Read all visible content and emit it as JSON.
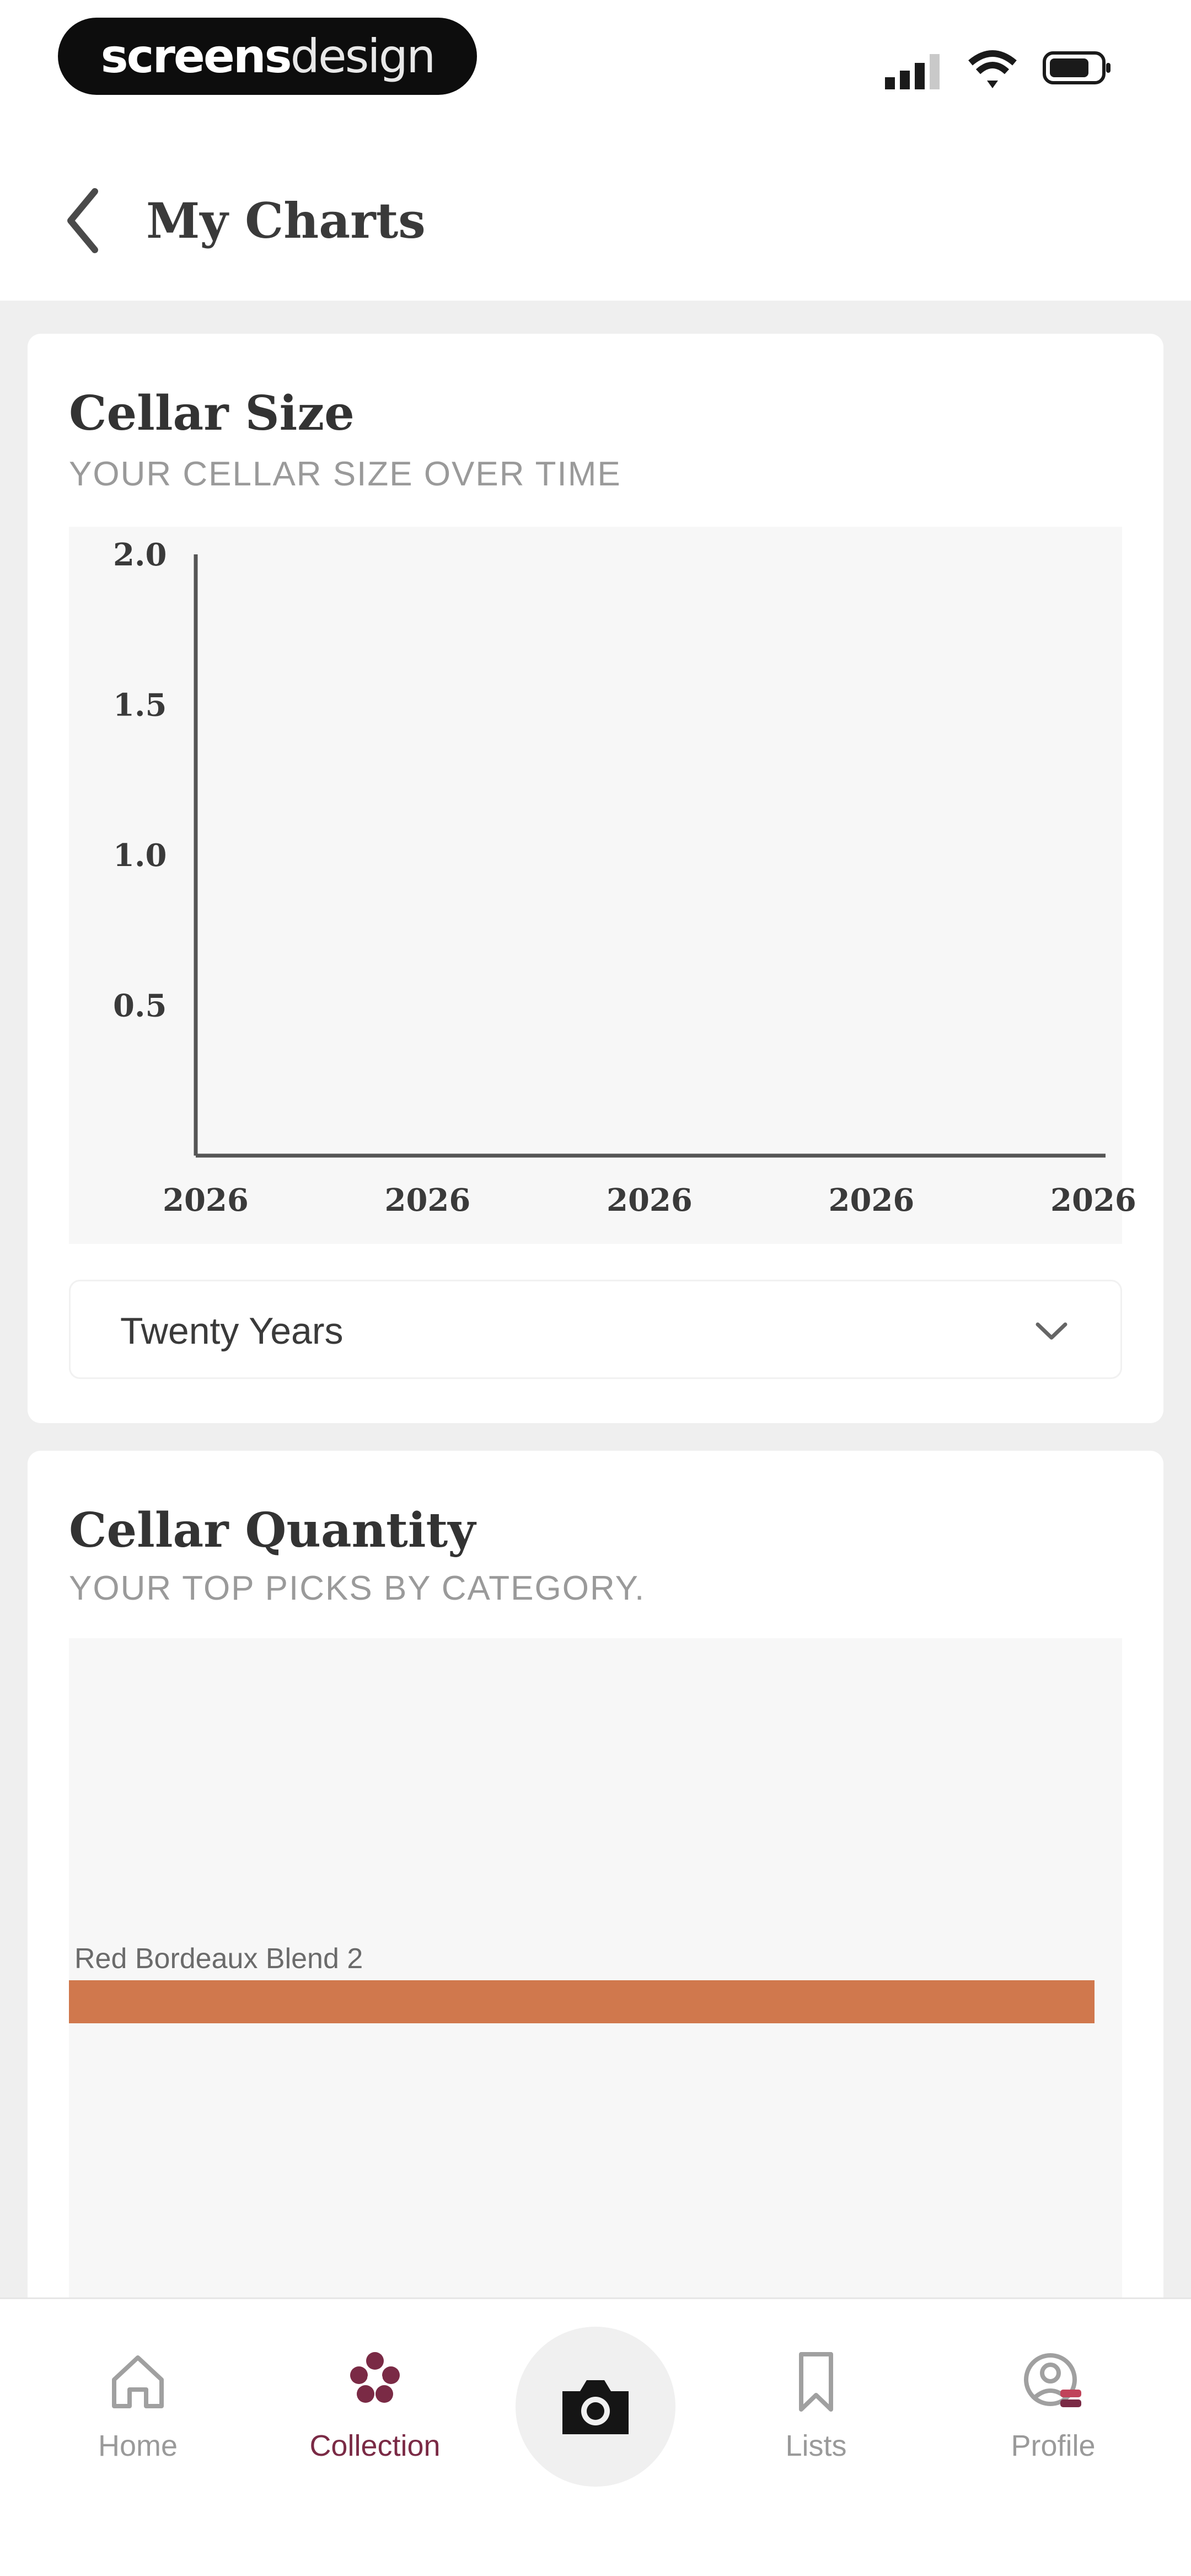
{
  "status_bar": {
    "brand_bold": "screens",
    "brand_light": "design"
  },
  "header": {
    "title": "My Charts",
    "back_icon": "chevron-left-icon"
  },
  "cellar_size_card": {
    "title": "Cellar Size",
    "subtitle": "YOUR CELLAR SIZE OVER TIME",
    "range_select": {
      "value": "Twenty Years",
      "icon": "chevron-down-icon"
    }
  },
  "cellar_quantity_card": {
    "title": "Cellar Quantity",
    "subtitle": "YOUR TOP PICKS BY CATEGORY."
  },
  "chart_data": [
    {
      "type": "line",
      "title": "Cellar Size",
      "subtitle": "YOUR CELLAR SIZE OVER TIME",
      "x_tick_labels": [
        "2026",
        "2026",
        "2026",
        "2026",
        "2026"
      ],
      "y_tick_labels": [
        "2.0",
        "1.5",
        "1.0",
        "0.5"
      ],
      "y_ticks": [
        2.0,
        1.5,
        1.0,
        0.5
      ],
      "ylim": [
        0,
        2.0
      ],
      "series": [],
      "grid": false
    },
    {
      "type": "bar",
      "orientation": "horizontal",
      "title": "Cellar Quantity",
      "subtitle": "YOUR TOP PICKS BY CATEGORY.",
      "categories": [
        "Red Bordeaux Blend 2"
      ],
      "values": [
        2
      ],
      "xlim": [
        0,
        2
      ],
      "bar_color": "#d0784d",
      "grid": false
    }
  ],
  "tab_bar": {
    "tabs": [
      {
        "label": "Home",
        "icon": "home-icon",
        "active": false
      },
      {
        "label": "Collection",
        "icon": "collection-icon",
        "active": true
      },
      {
        "label": "Lists",
        "icon": "bookmark-icon",
        "active": false
      },
      {
        "label": "Profile",
        "icon": "profile-icon",
        "active": false
      }
    ],
    "camera_icon": "camera-icon"
  },
  "colors": {
    "accent": "#7a2a45",
    "bar": "#d0784d",
    "page_background": "#efefef",
    "chart_background": "#f7f7f7"
  }
}
